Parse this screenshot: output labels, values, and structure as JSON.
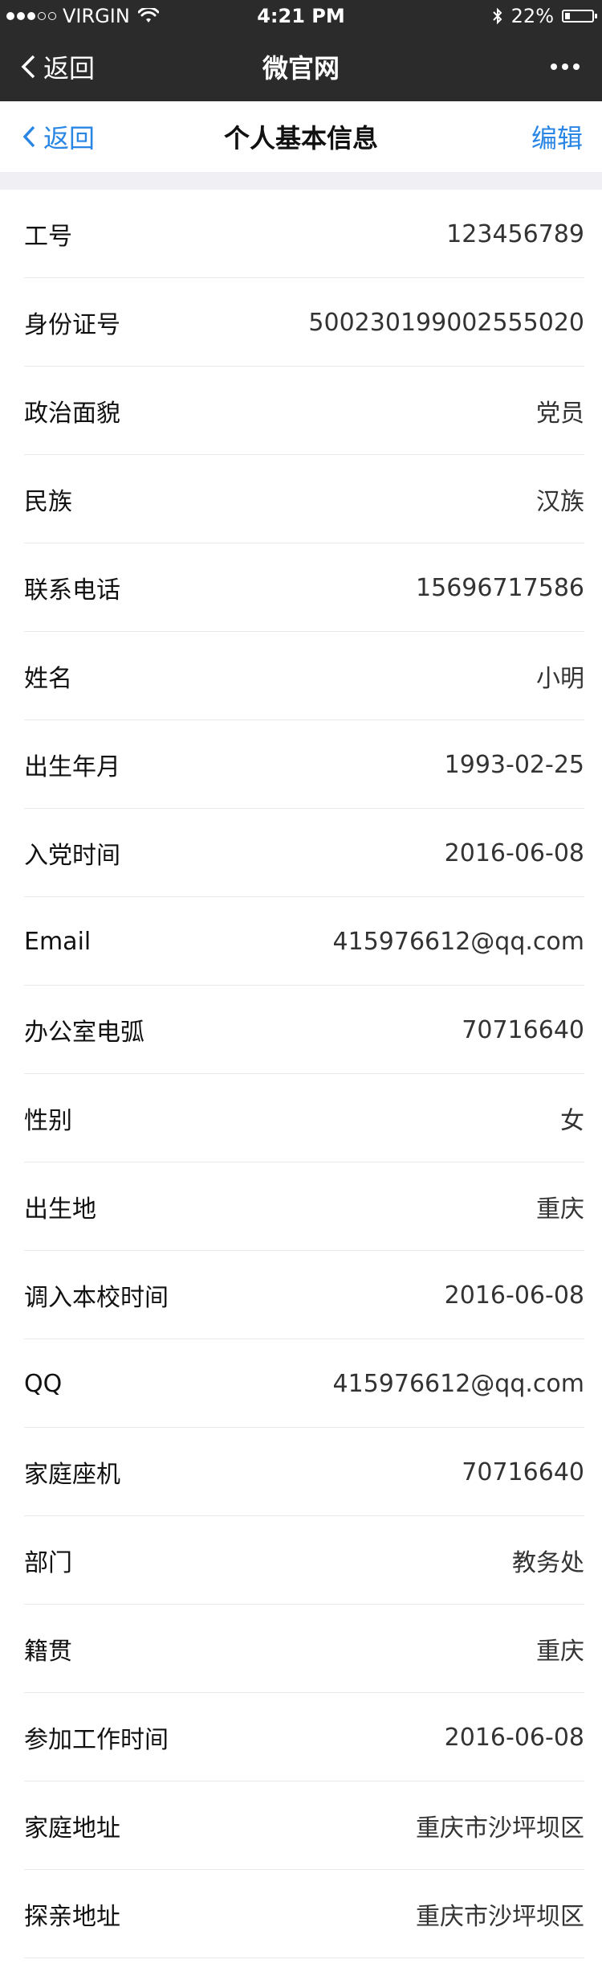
{
  "status_bar": {
    "carrier": "VIRGIN",
    "time": "4:21 PM",
    "battery": "22%"
  },
  "app_header": {
    "back_label": "返回",
    "title": "微官网"
  },
  "page_nav": {
    "back_label": "返回",
    "title": "个人基本信息",
    "edit_label": "编辑"
  },
  "profile": {
    "rows": [
      {
        "label": "工号",
        "value": "123456789"
      },
      {
        "label": "身份证号",
        "value": "500230199002555020"
      },
      {
        "label": "政治面貌",
        "value": "党员"
      },
      {
        "label": "民族",
        "value": "汉族"
      },
      {
        "label": "联系电话",
        "value": "15696717586"
      },
      {
        "label": "姓名",
        "value": "小明"
      },
      {
        "label": "出生年月",
        "value": "1993-02-25"
      },
      {
        "label": "入党时间",
        "value": "2016-06-08"
      },
      {
        "label": "Email",
        "value": "415976612@qq.com"
      },
      {
        "label": "办公室电弧",
        "value": "70716640"
      },
      {
        "label": "性别",
        "value": "女"
      },
      {
        "label": "出生地",
        "value": "重庆"
      },
      {
        "label": "调入本校时间",
        "value": "2016-06-08"
      },
      {
        "label": "QQ",
        "value": "415976612@qq.com"
      },
      {
        "label": "家庭座机",
        "value": "70716640"
      },
      {
        "label": "部门",
        "value": "教务处"
      },
      {
        "label": "籍贯",
        "value": "重庆"
      },
      {
        "label": "参加工作时间",
        "value": "2016-06-08"
      },
      {
        "label": "家庭地址",
        "value": "重庆市沙坪坝区"
      },
      {
        "label": "探亲地址",
        "value": "重庆市沙坪坝区"
      }
    ]
  },
  "colors": {
    "accent": "#2a86e4",
    "header_bg": "#2b2b2b"
  }
}
